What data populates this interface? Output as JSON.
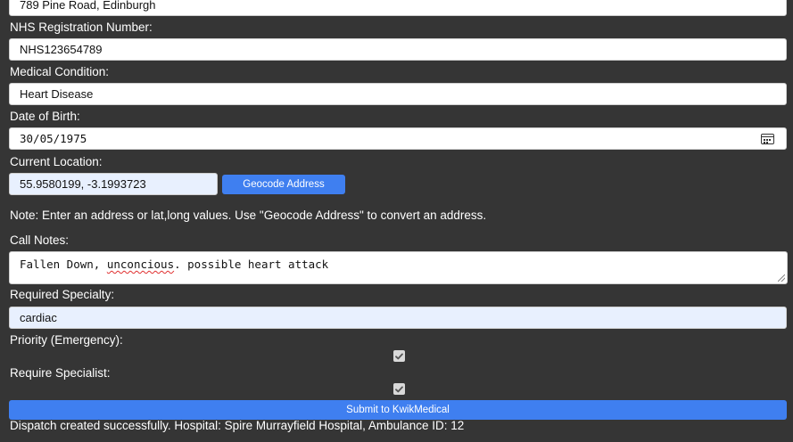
{
  "form": {
    "address_value": "789 Pine Road, Edinburgh",
    "nhs_label": "NHS Registration Number:",
    "nhs_value": "NHS123654789",
    "condition_label": "Medical Condition:",
    "condition_value": "Heart Disease",
    "dob_label": "Date of Birth:",
    "dob_value": "30/05/1975",
    "location_label": "Current Location:",
    "location_value": "55.9580199, -3.1993723",
    "geocode_button": "Geocode Address",
    "note_text": "Note: Enter an address or lat,long values. Use \"Geocode Address\" to convert an address.",
    "call_notes_label": "Call Notes:",
    "call_notes_before": "Fallen Down, ",
    "call_notes_misspelled": "unconcious",
    "call_notes_after": ". possible heart attack",
    "specialty_label": "Required Specialty:",
    "specialty_value": "cardiac",
    "priority_label": "Priority (Emergency):",
    "priority_checked": true,
    "specialist_label": "Require Specialist:",
    "specialist_checked": true,
    "submit_button": "Submit to KwikMedical",
    "status_message": "Dispatch created successfully. Hospital: Spire Murrayfield Hospital, Ambulance ID: 12"
  },
  "icons": {
    "date_picker": "calendar-icon",
    "checkmark": "check-icon"
  },
  "colors": {
    "background": "#353535",
    "button": "#3f7ff0",
    "autofill": "#e8f0fe"
  }
}
